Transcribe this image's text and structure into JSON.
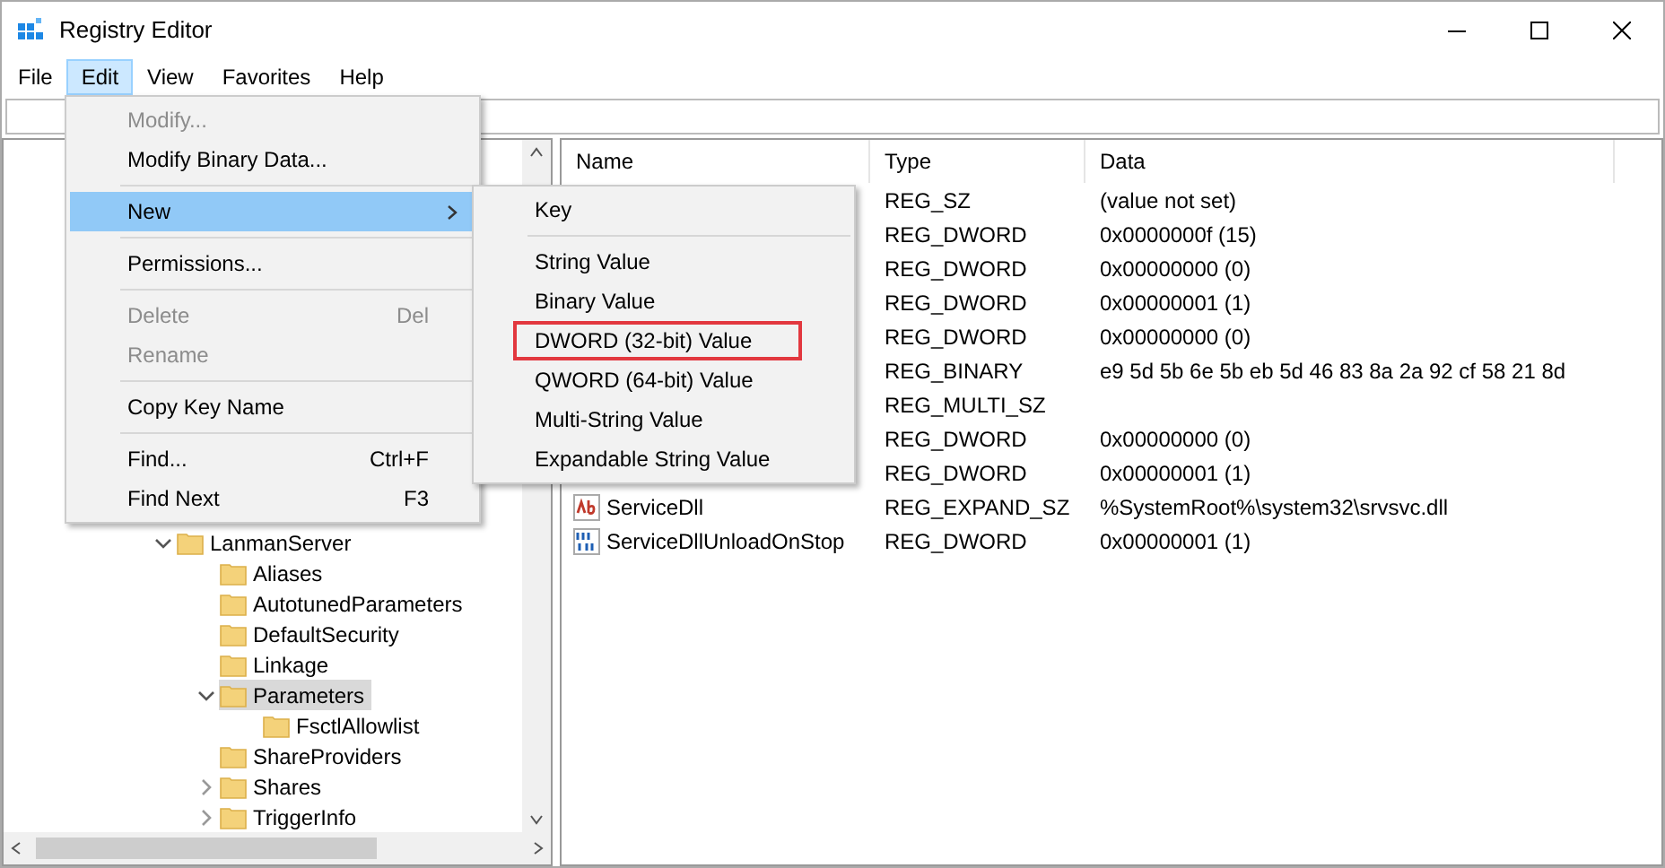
{
  "window": {
    "title": "Registry Editor"
  },
  "menu_bar": [
    {
      "label": "File",
      "selected": false
    },
    {
      "label": "Edit",
      "selected": true
    },
    {
      "label": "View",
      "selected": false
    },
    {
      "label": "Favorites",
      "selected": false
    },
    {
      "label": "Help",
      "selected": false
    }
  ],
  "tree": [
    {
      "label": "LanmanServer",
      "expanded": true,
      "selected": false,
      "children": [
        {
          "label": "Aliases",
          "selected": false
        },
        {
          "label": "AutotunedParameters",
          "selected": false
        },
        {
          "label": "DefaultSecurity",
          "selected": false
        },
        {
          "label": "Linkage",
          "selected": false
        },
        {
          "label": "Parameters",
          "expanded": true,
          "selected": true,
          "children": [
            {
              "label": "FsctlAllowlist",
              "selected": false
            }
          ]
        },
        {
          "label": "ShareProviders",
          "selected": false
        },
        {
          "label": "Shares",
          "expanded": false,
          "selected": false
        },
        {
          "label": "TriggerInfo",
          "expanded": false,
          "selected": false
        }
      ]
    }
  ],
  "values_table": {
    "columns": [
      "Name",
      "Type",
      "Data"
    ],
    "rows": [
      {
        "type": "REG_SZ",
        "data": "(value not set)"
      },
      {
        "type": "REG_DWORD",
        "data": "0x0000000f (15)"
      },
      {
        "type": "REG_DWORD",
        "data": "0x00000000 (0)"
      },
      {
        "type": "REG_DWORD",
        "data": "0x00000001 (1)"
      },
      {
        "type": "REG_DWORD",
        "data": "0x00000000 (0)"
      },
      {
        "type": "REG_BINARY",
        "data": "e9 5d 5b 6e 5b eb 5d 46 83 8a 2a 92 cf 58 21 8d"
      },
      {
        "type": "REG_MULTI_SZ"
      },
      {
        "type": "REG_DWORD",
        "data": "0x00000000 (0)"
      },
      {
        "type": "REG_DWORD",
        "data": "0x00000001 (1)"
      },
      {
        "name": "ServiceDll",
        "kind": "string",
        "type": "REG_EXPAND_SZ",
        "data": "%SystemRoot%\\system32\\srvsvc.dll"
      },
      {
        "name": "ServiceDllUnloadOnStop",
        "kind": "binary",
        "type": "REG_DWORD",
        "data": "0x00000001 (1)"
      }
    ]
  },
  "edit_menu": [
    {
      "kind": "item",
      "label": "Modify...",
      "disabled": true,
      "selected": false
    },
    {
      "kind": "item",
      "label": "Modify Binary Data...",
      "disabled": false,
      "selected": false
    },
    {
      "kind": "separator"
    },
    {
      "kind": "submenu",
      "label": "New",
      "disabled": false,
      "selected": true
    },
    {
      "kind": "separator"
    },
    {
      "kind": "item",
      "label": "Permissions...",
      "disabled": false,
      "selected": false
    },
    {
      "kind": "separator"
    },
    {
      "kind": "item",
      "label": "Delete",
      "shortcut": "Del",
      "disabled": true,
      "selected": false
    },
    {
      "kind": "item",
      "label": "Rename",
      "disabled": true,
      "selected": false
    },
    {
      "kind": "separator"
    },
    {
      "kind": "item",
      "label": "Copy Key Name",
      "disabled": false,
      "selected": false
    },
    {
      "kind": "separator"
    },
    {
      "kind": "item",
      "label": "Find...",
      "shortcut": "Ctrl+F",
      "disabled": false,
      "selected": false
    },
    {
      "kind": "item",
      "label": "Find Next",
      "shortcut": "F3",
      "disabled": false,
      "selected": false
    }
  ],
  "new_submenu": [
    {
      "kind": "item",
      "label": "Key",
      "outlined": false
    },
    {
      "kind": "separator"
    },
    {
      "kind": "item",
      "label": "String Value",
      "outlined": false
    },
    {
      "kind": "item",
      "label": "Binary Value",
      "outlined": false
    },
    {
      "kind": "item",
      "label": "DWORD (32-bit) Value",
      "outlined": true
    },
    {
      "kind": "item",
      "label": "QWORD (64-bit) Value",
      "outlined": false
    },
    {
      "kind": "item",
      "label": "Multi-String Value",
      "outlined": false
    },
    {
      "kind": "item",
      "label": "Expandable String Value",
      "outlined": false
    }
  ]
}
